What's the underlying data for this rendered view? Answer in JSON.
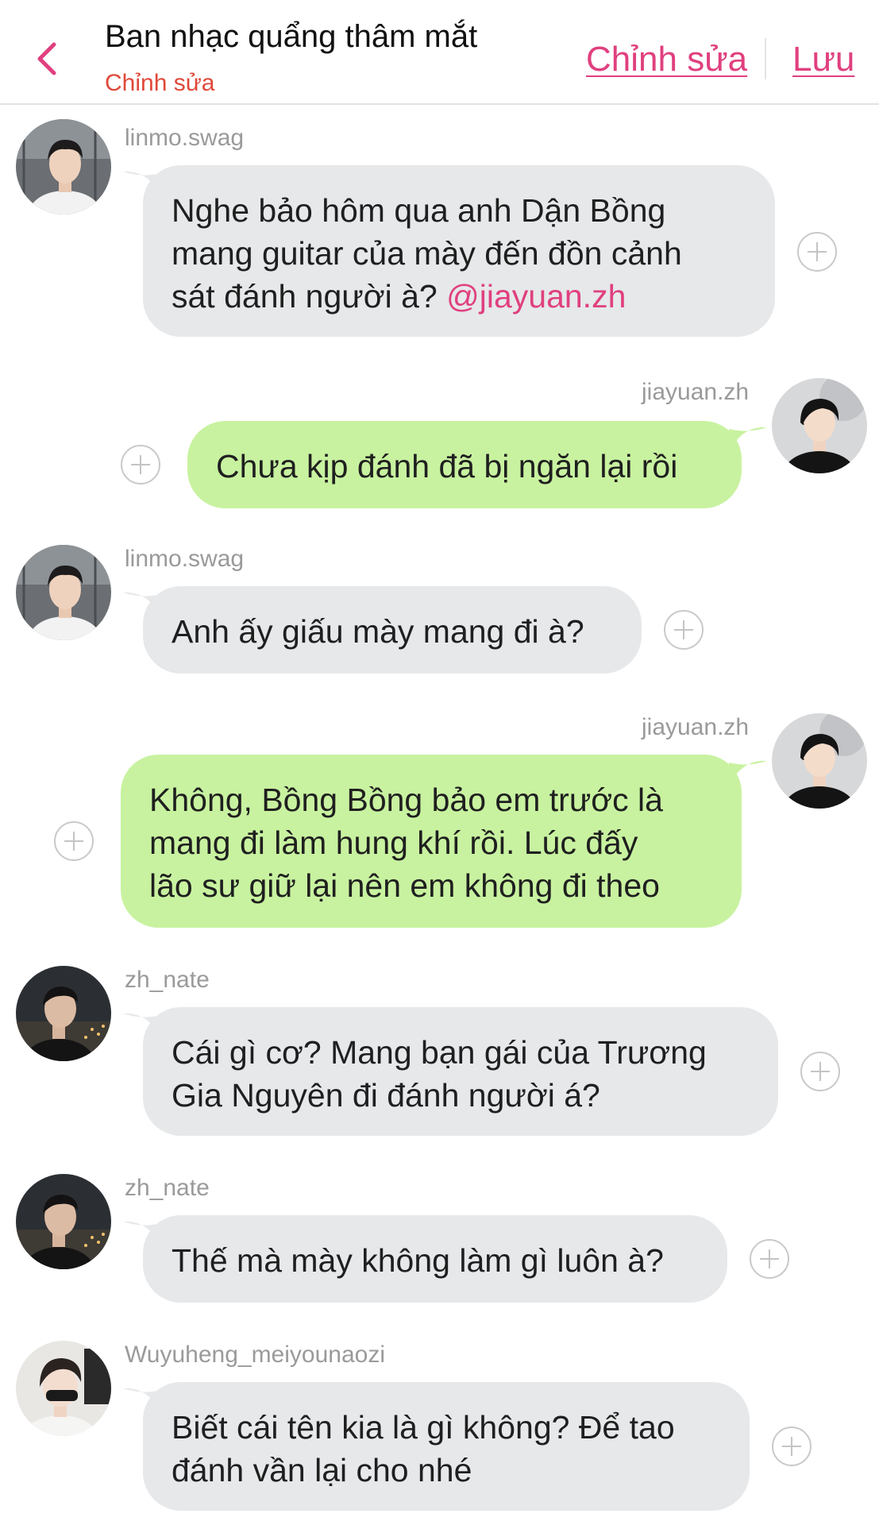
{
  "header": {
    "back_icon": "chevron-left-icon",
    "title": "Ban nhạc quẩng thâm mắt",
    "subtitle": "Chỉnh sửa",
    "edit_label": "Chỉnh sửa",
    "save_label": "Lưu",
    "accent_color": "#e0407f",
    "subtitle_color": "#e0483a"
  },
  "colors": {
    "incoming_bubble": "#e6e8ea",
    "outgoing_bubble": "#c8f2a0",
    "username": "#9a9a9a"
  },
  "messages": [
    {
      "user": "linmo.swag",
      "side": "left",
      "lines": [
        "Nghe bảo hôm qua anh Dận Bồng",
        "mang guitar của mày đến đồn cảnh"
      ],
      "last_line_text": "sát đánh người à? ",
      "mention": "@jiayuan.zh"
    },
    {
      "user": "jiayuan.zh",
      "side": "right",
      "lines": [
        "Chưa kịp đánh đã bị ngăn lại rồi"
      ]
    },
    {
      "user": "linmo.swag",
      "side": "left",
      "lines": [
        "Anh ấy giấu mày mang đi à?"
      ]
    },
    {
      "user": "jiayuan.zh",
      "side": "right",
      "lines": [
        "Không, Bồng Bồng bảo em trước là",
        "mang đi làm hung khí rồi. Lúc đấy",
        "lão sư giữ lại nên em không đi theo"
      ]
    },
    {
      "user": "zh_nate",
      "side": "left",
      "lines": [
        "Cái gì cơ? Mang bạn gái của Trương",
        "Gia Nguyên đi đánh người á?"
      ]
    },
    {
      "user": "zh_nate",
      "side": "left",
      "lines": [
        "Thế mà mày không làm gì luôn à?"
      ]
    },
    {
      "user": "Wuyuheng_meiyounaozi",
      "side": "left",
      "lines": [
        "Biết cái tên kia là gì không? Để tao",
        "đánh vần lại cho nhé"
      ]
    }
  ],
  "icons": {
    "react": "add-reaction-icon",
    "avatar": "avatar"
  }
}
